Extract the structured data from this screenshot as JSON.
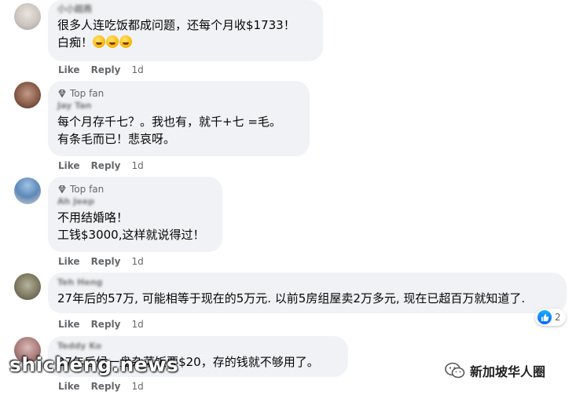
{
  "comments": [
    {
      "badge": "",
      "name": "小小超燕",
      "text": "很多人连吃饭都成问题，还每个月收$1733！\n白痴！",
      "emoji_count": 3,
      "like": "Like",
      "reply": "Reply",
      "time": "1d"
    },
    {
      "badge": "Top fan",
      "name": "Jay Tan",
      "text": "每个月存千七？。我也有，就千+七 =毛。\n有条毛而已！悲哀呀。",
      "like": "Like",
      "reply": "Reply",
      "time": "1d"
    },
    {
      "badge": "Top fan",
      "name": "Ah Jeep",
      "text": "不用结婚咯！\n工钱$3000,这样就说得过！",
      "like": "Like",
      "reply": "Reply",
      "time": "1d"
    },
    {
      "badge": "",
      "name": "Teh Heng",
      "text": "27年后的57万, 可能相等于现在的5万元. 以前5房组屋卖2万多元, 现在已超百万就知道了.",
      "like": "Like",
      "reply": "Reply",
      "time": "1d",
      "reaction_count": "2"
    },
    {
      "badge": "",
      "name": "Teddy Ko",
      "text": "27年后候一盘杂菜饭要$20，存的钱就不够用了。",
      "like": "Like",
      "reply": "Reply",
      "time": "1d"
    }
  ],
  "watermark": "shicheng.news",
  "wechat_label": "新加坡华人圈",
  "colors": {
    "bubble": "#f0f2f5",
    "muted": "#65676b",
    "like_blue": "#0866ff"
  }
}
